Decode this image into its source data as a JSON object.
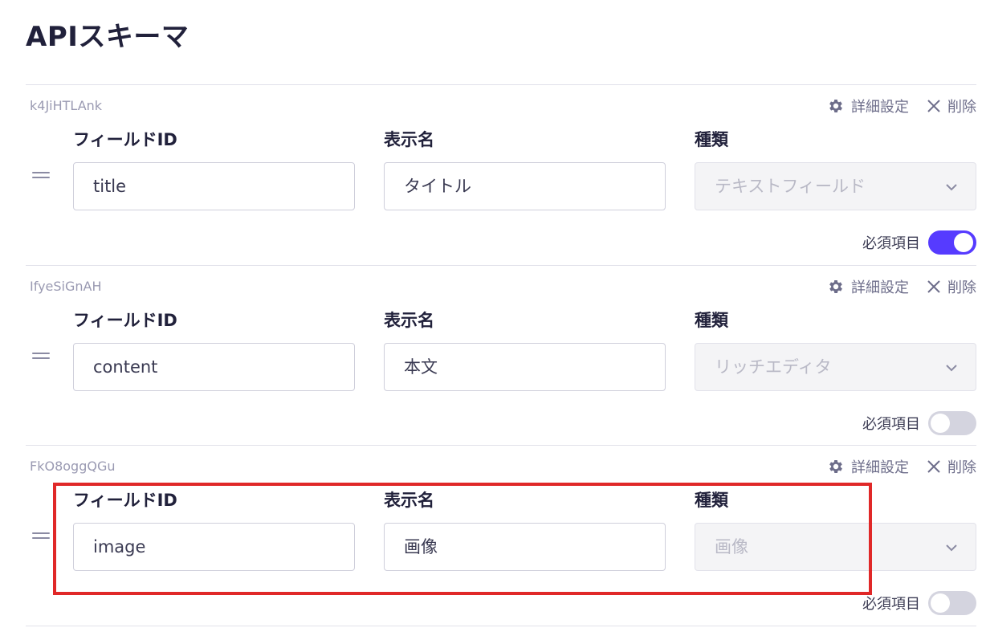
{
  "page": {
    "title": "APIスキーマ"
  },
  "labels": {
    "field_id": "フィールドID",
    "display_name": "表示名",
    "kind": "種類",
    "settings": "詳細設定",
    "delete": "削除",
    "required": "必須項目"
  },
  "icons": {
    "settings": "gear-icon",
    "delete": "close-icon",
    "drag": "drag-handle-icon",
    "select": "chevron-down-icon"
  },
  "colors": {
    "accent": "#563bff",
    "highlight": "#e02828"
  },
  "fields": [
    {
      "key": "k4JiHTLAnk",
      "field_id": "title",
      "display_name": "タイトル",
      "kind": "テキストフィールド",
      "required": true
    },
    {
      "key": "IfyeSiGnAH",
      "field_id": "content",
      "display_name": "本文",
      "kind": "リッチエディタ",
      "required": false
    },
    {
      "key": "FkO8oggQGu",
      "field_id": "image",
      "display_name": "画像",
      "kind": "画像",
      "required": false
    }
  ]
}
